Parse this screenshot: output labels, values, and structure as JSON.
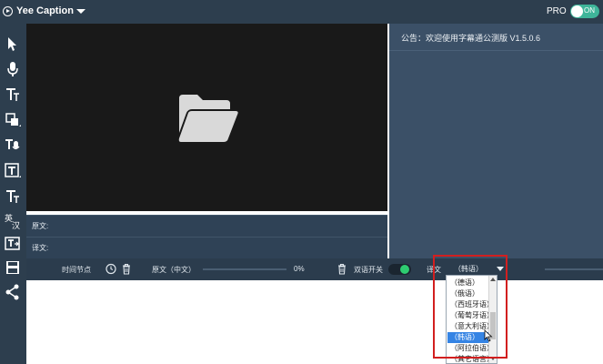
{
  "app": {
    "title": "Yee Caption",
    "pro_label": "PRO",
    "pro_toggle_text": "ON"
  },
  "notice": {
    "text": "公告：欢迎使用字幕通公测版 V1.5.0.6"
  },
  "subtitle": {
    "source_label": "原文:",
    "translation_label": "译文:"
  },
  "bottom_bar": {
    "time_node": "时间节点",
    "source_lang": "原文（中文）",
    "progress": "0%",
    "bilingual_switch": "双语开关",
    "translation": "译文",
    "selected_lang": "（韩语）"
  },
  "dropdown": {
    "options": [
      "（德语）",
      "（俄语）",
      "（西班牙语）",
      "（葡萄牙语）",
      "（意大利语）",
      "（韩语）",
      "（阿拉伯语）",
      "（其它语言）"
    ],
    "selected_index": 5
  },
  "colors": {
    "accent": "#3fb59a",
    "toggle_on": "#2ecc71",
    "highlight": "#d21f1f",
    "selection": "#3584e4"
  }
}
